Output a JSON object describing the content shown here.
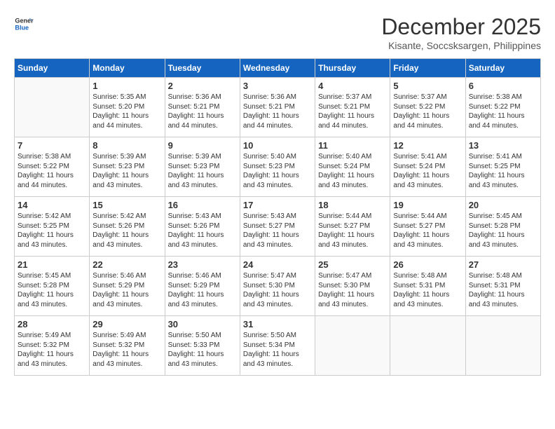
{
  "header": {
    "logo_line1": "General",
    "logo_line2": "Blue",
    "month_title": "December 2025",
    "location": "Kisante, Soccsksargen, Philippines"
  },
  "calendar": {
    "days_of_week": [
      "Sunday",
      "Monday",
      "Tuesday",
      "Wednesday",
      "Thursday",
      "Friday",
      "Saturday"
    ],
    "weeks": [
      [
        {
          "day": "",
          "sunrise": "",
          "sunset": "",
          "daylight": ""
        },
        {
          "day": "1",
          "sunrise": "Sunrise: 5:35 AM",
          "sunset": "Sunset: 5:20 PM",
          "daylight": "Daylight: 11 hours and 44 minutes."
        },
        {
          "day": "2",
          "sunrise": "Sunrise: 5:36 AM",
          "sunset": "Sunset: 5:21 PM",
          "daylight": "Daylight: 11 hours and 44 minutes."
        },
        {
          "day": "3",
          "sunrise": "Sunrise: 5:36 AM",
          "sunset": "Sunset: 5:21 PM",
          "daylight": "Daylight: 11 hours and 44 minutes."
        },
        {
          "day": "4",
          "sunrise": "Sunrise: 5:37 AM",
          "sunset": "Sunset: 5:21 PM",
          "daylight": "Daylight: 11 hours and 44 minutes."
        },
        {
          "day": "5",
          "sunrise": "Sunrise: 5:37 AM",
          "sunset": "Sunset: 5:22 PM",
          "daylight": "Daylight: 11 hours and 44 minutes."
        },
        {
          "day": "6",
          "sunrise": "Sunrise: 5:38 AM",
          "sunset": "Sunset: 5:22 PM",
          "daylight": "Daylight: 11 hours and 44 minutes."
        }
      ],
      [
        {
          "day": "7",
          "sunrise": "Sunrise: 5:38 AM",
          "sunset": "Sunset: 5:22 PM",
          "daylight": "Daylight: 11 hours and 44 minutes."
        },
        {
          "day": "8",
          "sunrise": "Sunrise: 5:39 AM",
          "sunset": "Sunset: 5:23 PM",
          "daylight": "Daylight: 11 hours and 43 minutes."
        },
        {
          "day": "9",
          "sunrise": "Sunrise: 5:39 AM",
          "sunset": "Sunset: 5:23 PM",
          "daylight": "Daylight: 11 hours and 43 minutes."
        },
        {
          "day": "10",
          "sunrise": "Sunrise: 5:40 AM",
          "sunset": "Sunset: 5:23 PM",
          "daylight": "Daylight: 11 hours and 43 minutes."
        },
        {
          "day": "11",
          "sunrise": "Sunrise: 5:40 AM",
          "sunset": "Sunset: 5:24 PM",
          "daylight": "Daylight: 11 hours and 43 minutes."
        },
        {
          "day": "12",
          "sunrise": "Sunrise: 5:41 AM",
          "sunset": "Sunset: 5:24 PM",
          "daylight": "Daylight: 11 hours and 43 minutes."
        },
        {
          "day": "13",
          "sunrise": "Sunrise: 5:41 AM",
          "sunset": "Sunset: 5:25 PM",
          "daylight": "Daylight: 11 hours and 43 minutes."
        }
      ],
      [
        {
          "day": "14",
          "sunrise": "Sunrise: 5:42 AM",
          "sunset": "Sunset: 5:25 PM",
          "daylight": "Daylight: 11 hours and 43 minutes."
        },
        {
          "day": "15",
          "sunrise": "Sunrise: 5:42 AM",
          "sunset": "Sunset: 5:26 PM",
          "daylight": "Daylight: 11 hours and 43 minutes."
        },
        {
          "day": "16",
          "sunrise": "Sunrise: 5:43 AM",
          "sunset": "Sunset: 5:26 PM",
          "daylight": "Daylight: 11 hours and 43 minutes."
        },
        {
          "day": "17",
          "sunrise": "Sunrise: 5:43 AM",
          "sunset": "Sunset: 5:27 PM",
          "daylight": "Daylight: 11 hours and 43 minutes."
        },
        {
          "day": "18",
          "sunrise": "Sunrise: 5:44 AM",
          "sunset": "Sunset: 5:27 PM",
          "daylight": "Daylight: 11 hours and 43 minutes."
        },
        {
          "day": "19",
          "sunrise": "Sunrise: 5:44 AM",
          "sunset": "Sunset: 5:27 PM",
          "daylight": "Daylight: 11 hours and 43 minutes."
        },
        {
          "day": "20",
          "sunrise": "Sunrise: 5:45 AM",
          "sunset": "Sunset: 5:28 PM",
          "daylight": "Daylight: 11 hours and 43 minutes."
        }
      ],
      [
        {
          "day": "21",
          "sunrise": "Sunrise: 5:45 AM",
          "sunset": "Sunset: 5:28 PM",
          "daylight": "Daylight: 11 hours and 43 minutes."
        },
        {
          "day": "22",
          "sunrise": "Sunrise: 5:46 AM",
          "sunset": "Sunset: 5:29 PM",
          "daylight": "Daylight: 11 hours and 43 minutes."
        },
        {
          "day": "23",
          "sunrise": "Sunrise: 5:46 AM",
          "sunset": "Sunset: 5:29 PM",
          "daylight": "Daylight: 11 hours and 43 minutes."
        },
        {
          "day": "24",
          "sunrise": "Sunrise: 5:47 AM",
          "sunset": "Sunset: 5:30 PM",
          "daylight": "Daylight: 11 hours and 43 minutes."
        },
        {
          "day": "25",
          "sunrise": "Sunrise: 5:47 AM",
          "sunset": "Sunset: 5:30 PM",
          "daylight": "Daylight: 11 hours and 43 minutes."
        },
        {
          "day": "26",
          "sunrise": "Sunrise: 5:48 AM",
          "sunset": "Sunset: 5:31 PM",
          "daylight": "Daylight: 11 hours and 43 minutes."
        },
        {
          "day": "27",
          "sunrise": "Sunrise: 5:48 AM",
          "sunset": "Sunset: 5:31 PM",
          "daylight": "Daylight: 11 hours and 43 minutes."
        }
      ],
      [
        {
          "day": "28",
          "sunrise": "Sunrise: 5:49 AM",
          "sunset": "Sunset: 5:32 PM",
          "daylight": "Daylight: 11 hours and 43 minutes."
        },
        {
          "day": "29",
          "sunrise": "Sunrise: 5:49 AM",
          "sunset": "Sunset: 5:32 PM",
          "daylight": "Daylight: 11 hours and 43 minutes."
        },
        {
          "day": "30",
          "sunrise": "Sunrise: 5:50 AM",
          "sunset": "Sunset: 5:33 PM",
          "daylight": "Daylight: 11 hours and 43 minutes."
        },
        {
          "day": "31",
          "sunrise": "Sunrise: 5:50 AM",
          "sunset": "Sunset: 5:34 PM",
          "daylight": "Daylight: 11 hours and 43 minutes."
        },
        {
          "day": "",
          "sunrise": "",
          "sunset": "",
          "daylight": ""
        },
        {
          "day": "",
          "sunrise": "",
          "sunset": "",
          "daylight": ""
        },
        {
          "day": "",
          "sunrise": "",
          "sunset": "",
          "daylight": ""
        }
      ]
    ]
  }
}
